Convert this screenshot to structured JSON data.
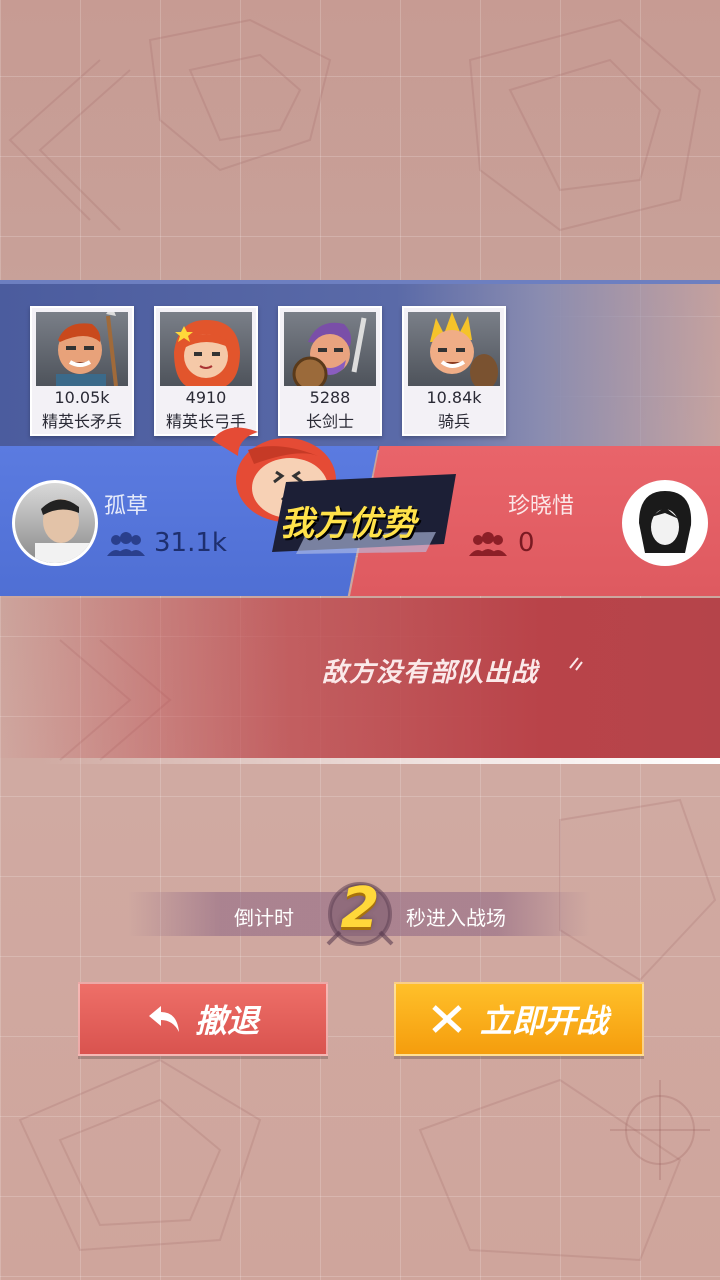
{
  "units": [
    {
      "value": "10.05k",
      "name": "精英长矛兵",
      "icon": "spearman-portrait"
    },
    {
      "value": "4910",
      "name": "精英长弓手",
      "icon": "archer-portrait"
    },
    {
      "value": "5288",
      "name": "长剑士",
      "icon": "swordsman-portrait"
    },
    {
      "value": "10.84k",
      "name": "骑兵",
      "icon": "cavalry-portrait"
    }
  ],
  "player_left": {
    "name": "孤草",
    "count": "31.1k",
    "color": "#4f6fd4"
  },
  "player_right": {
    "name": "珍晓惜",
    "count": "0",
    "color": "#de5a60"
  },
  "advantage_badge": "我方优势",
  "message": "敌方没有部队出战",
  "countdown": {
    "prefix": "倒计时",
    "number": "2",
    "suffix": "秒进入战场"
  },
  "buttons": {
    "retreat": "撤退",
    "fight": "立即开战"
  }
}
